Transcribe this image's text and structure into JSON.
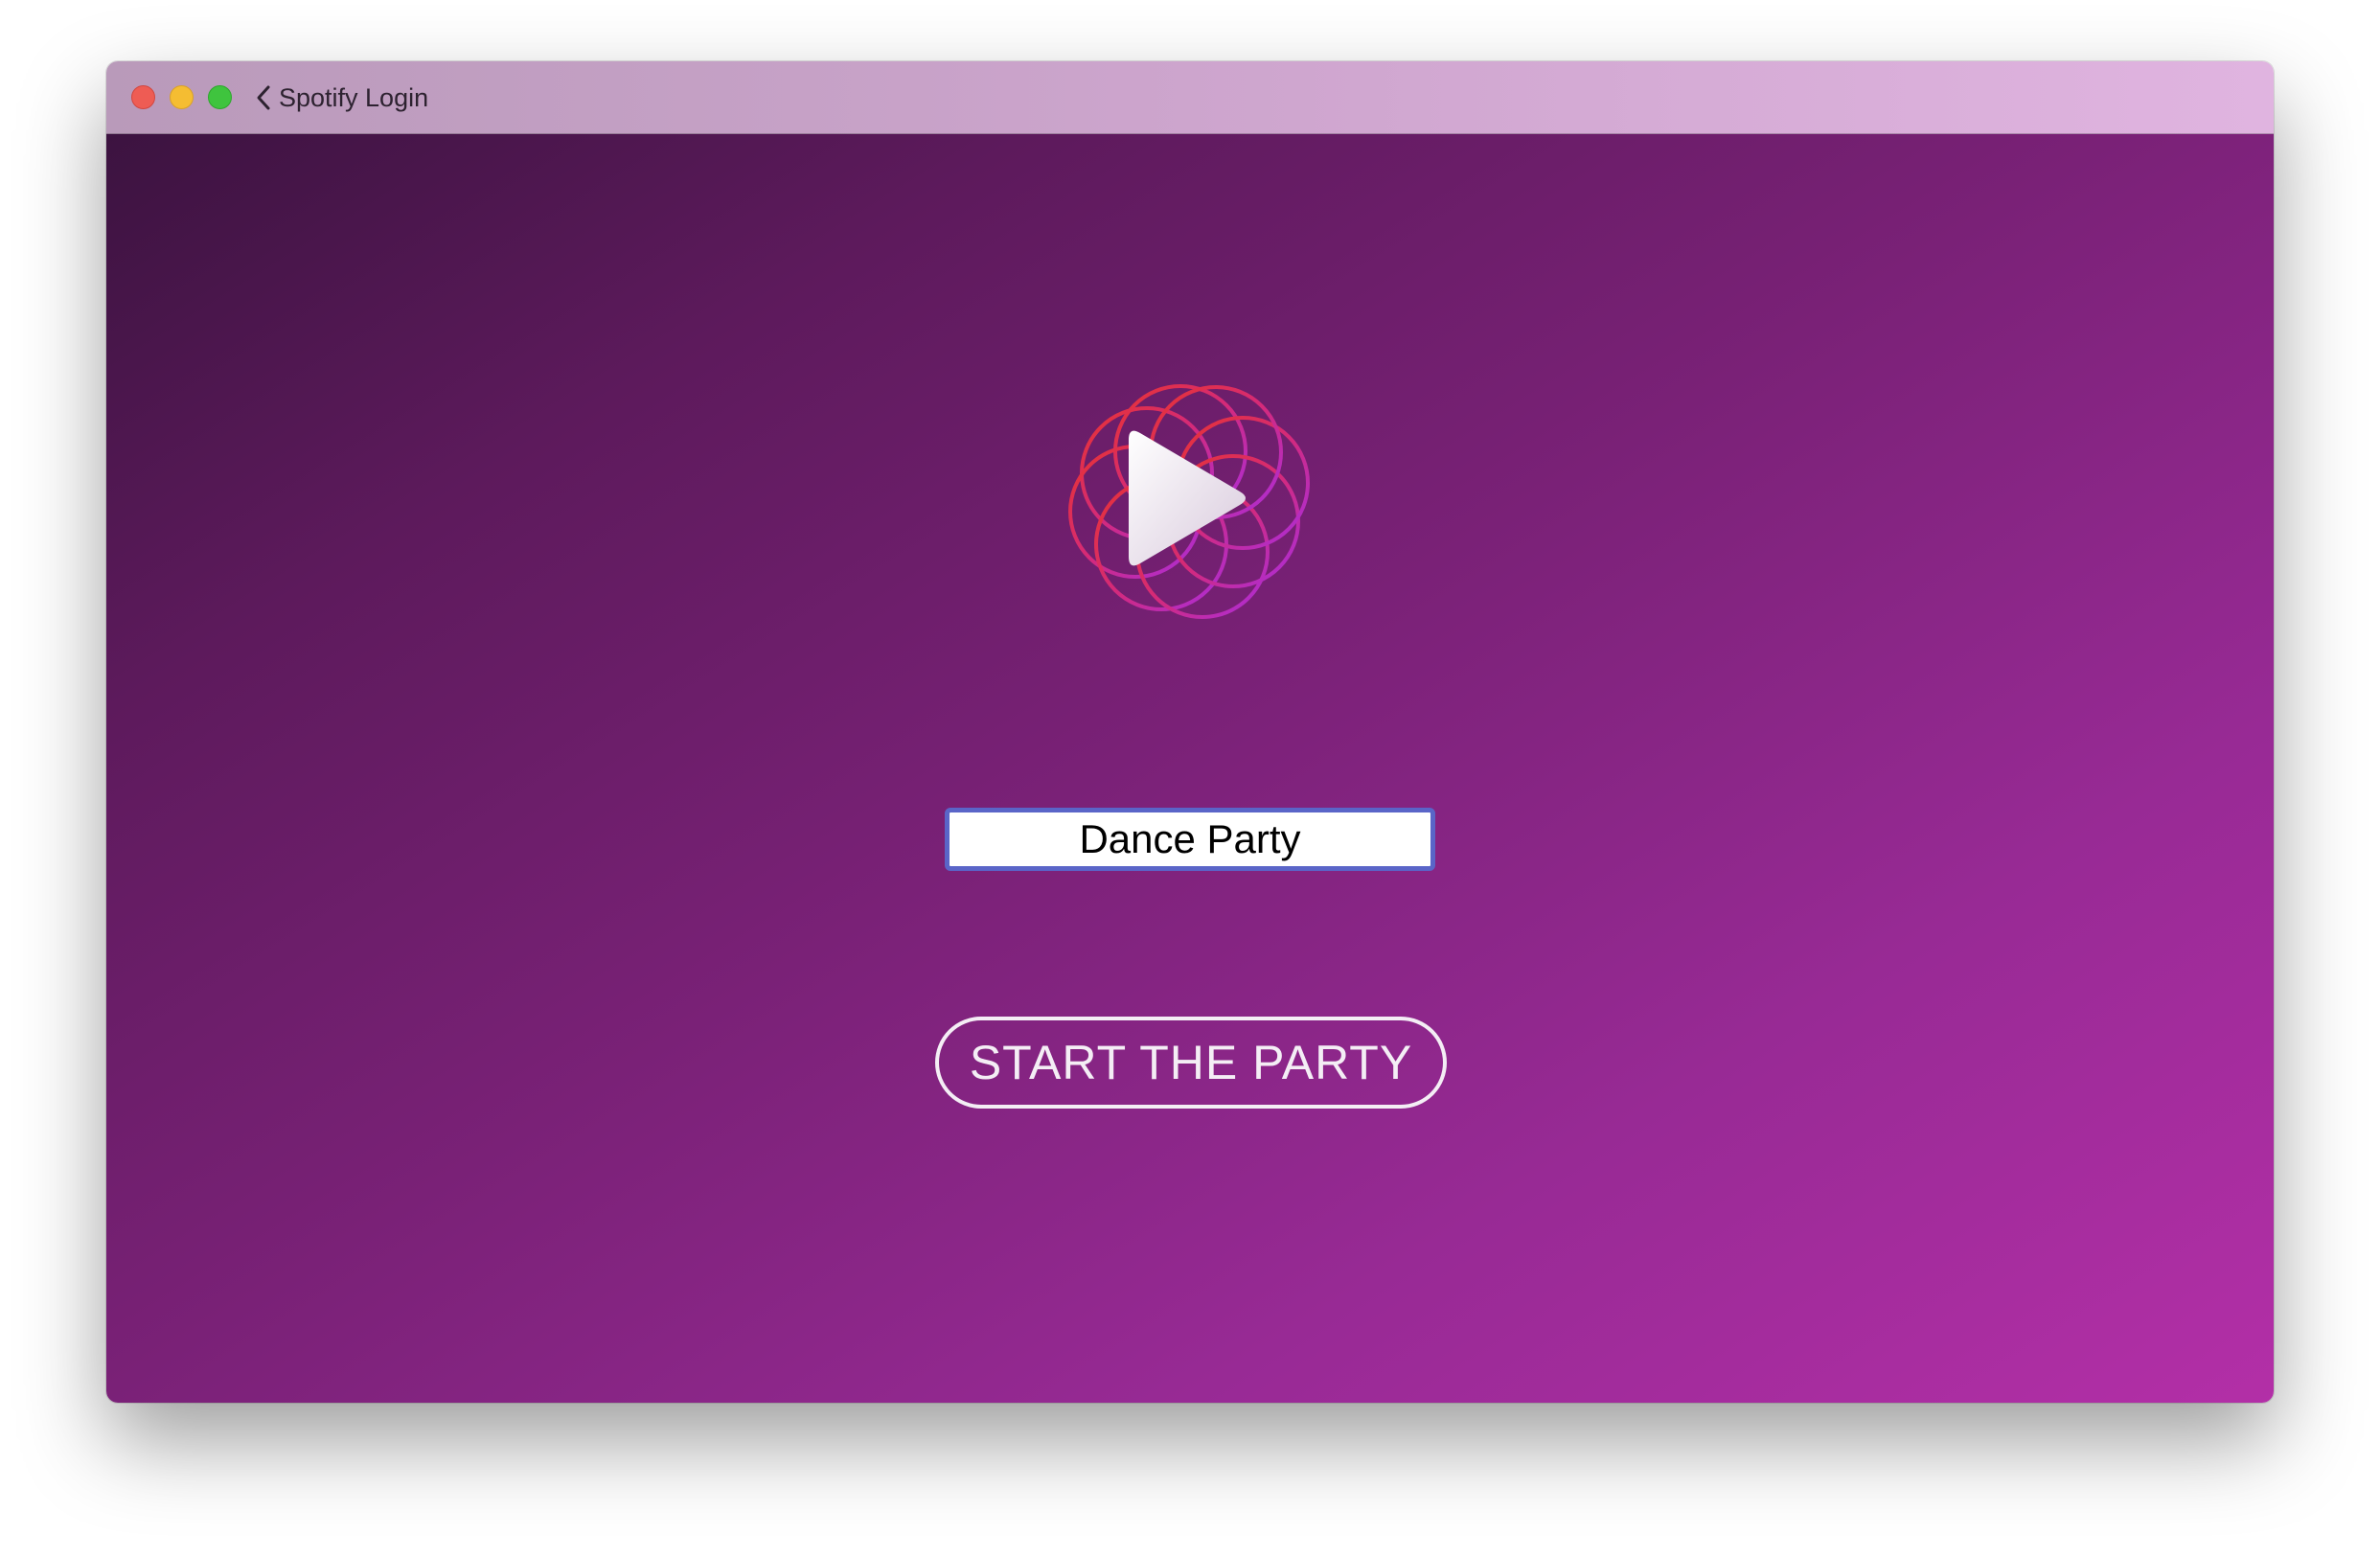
{
  "window": {
    "title": "Spotify Login",
    "back_icon": "chevron-left-icon"
  },
  "traffic_lights": {
    "close_color": "#ee5c54",
    "minimize_color": "#f5bd32",
    "maximize_color": "#3fc43e"
  },
  "main": {
    "logo_icon": "play-circles-logo-icon",
    "party_name_value": "Dance Party",
    "start_button_label": "START THE PARTY"
  },
  "colors": {
    "background_start": "#3c1340",
    "background_end": "#b32fa7",
    "input_focus_border": "#5a65c8",
    "button_outline": "#f4eef5"
  }
}
